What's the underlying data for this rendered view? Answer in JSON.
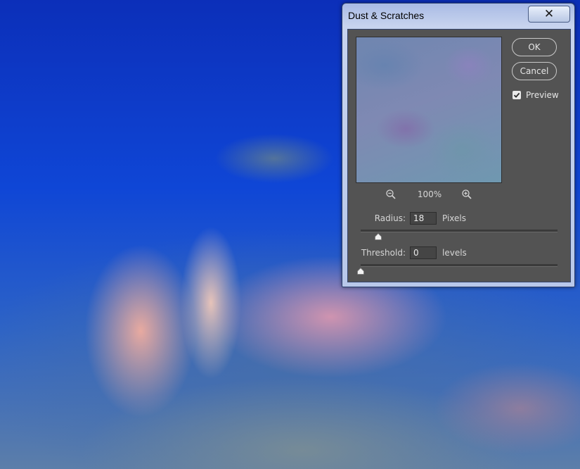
{
  "dialog": {
    "title": "Dust & Scratches",
    "close_label": "✕",
    "buttons": {
      "ok": "OK",
      "cancel": "Cancel"
    },
    "preview": {
      "label": "Preview",
      "checked": true
    },
    "zoom": {
      "level": "100%",
      "zoom_out_icon": "zoom-out-icon",
      "zoom_in_icon": "zoom-in-icon"
    },
    "radius": {
      "label": "Radius:",
      "value": "18",
      "unit": "Pixels",
      "slider_fraction": 0.09
    },
    "threshold": {
      "label": "Threshold:",
      "value": "0",
      "unit": "levels",
      "slider_fraction": 0.0
    }
  },
  "colors": {
    "dialog_body": "#535353",
    "title_gradient_top": "#a9bbe5",
    "canvas_blue": "#0f46d6"
  }
}
